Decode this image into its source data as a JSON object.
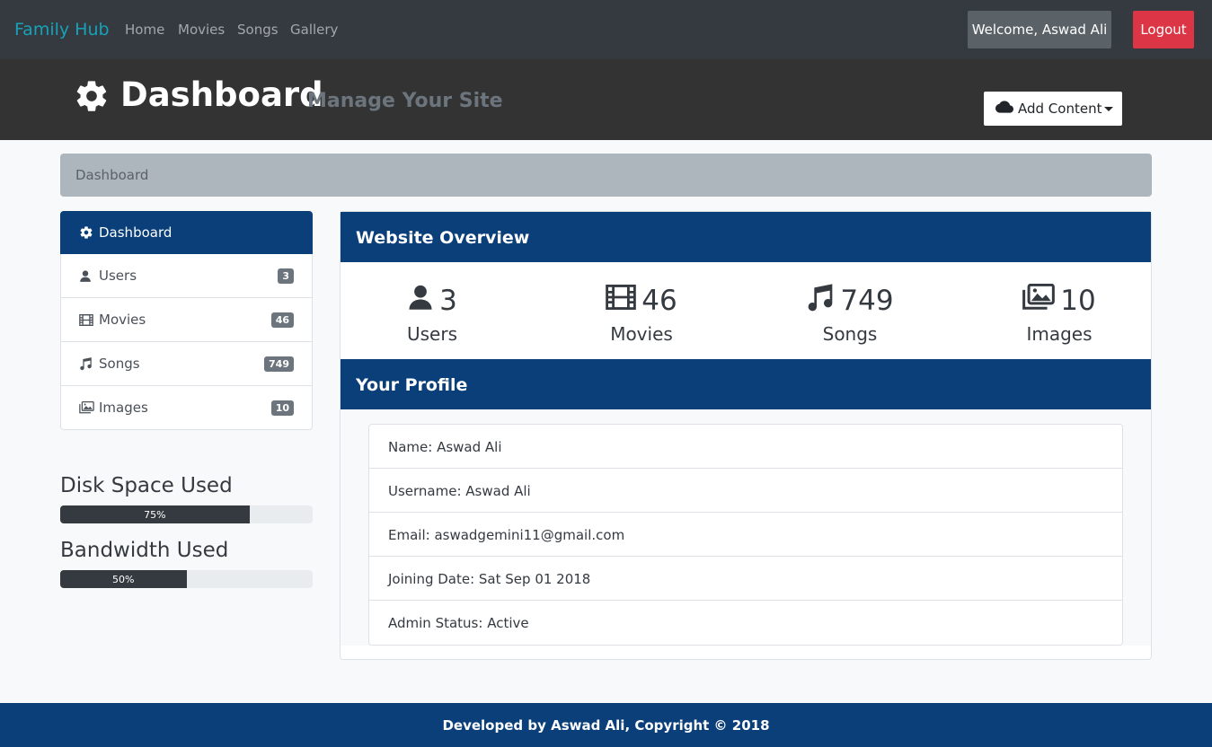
{
  "nav": {
    "brand": "Family Hub",
    "links": [
      "Home",
      "Movies",
      "Songs",
      "Gallery"
    ],
    "welcome": "Welcome, Aswad Ali",
    "logout": "Logout"
  },
  "header": {
    "title": "Dashboard",
    "subtitle": "Manage Your Site",
    "add_content": "Add Content"
  },
  "breadcrumb": "Dashboard",
  "sidebar": {
    "items": [
      {
        "label": "Dashboard",
        "icon": "gear-icon"
      },
      {
        "label": "Users",
        "icon": "user-icon",
        "count": "3"
      },
      {
        "label": "Movies",
        "icon": "film-icon",
        "count": "46"
      },
      {
        "label": "Songs",
        "icon": "music-icon",
        "count": "749"
      },
      {
        "label": "Images",
        "icon": "images-icon",
        "count": "10"
      }
    ]
  },
  "usage": {
    "disk_title": "Disk Space Used",
    "disk_percent": "75%",
    "disk_value": 75,
    "bandwidth_title": "Bandwidth Used",
    "bandwidth_percent": "50%",
    "bandwidth_value": 50
  },
  "overview": {
    "title": "Website Overview",
    "stats": [
      {
        "value": "3",
        "label": "Users",
        "icon": "user-icon"
      },
      {
        "value": "46",
        "label": "Movies",
        "icon": "film-icon"
      },
      {
        "value": "749",
        "label": "Songs",
        "icon": "music-icon"
      },
      {
        "value": "10",
        "label": "Images",
        "icon": "images-icon"
      }
    ]
  },
  "profile": {
    "title": "Your Profile",
    "name": "Name: Aswad Ali",
    "username": "Username: Aswad Ali",
    "email": "Email: aswadgemini11@gmail.com",
    "joining": "Joining Date: Sat Sep 01 2018",
    "admin": "Admin Status: Active"
  },
  "footer": "Developed by Aswad Ali, Copyright © 2018",
  "colors": {
    "navbar": "#343a40",
    "brand": "#17a2b8",
    "primary_dark": "#0a3f7a",
    "logout": "#dc3545"
  }
}
